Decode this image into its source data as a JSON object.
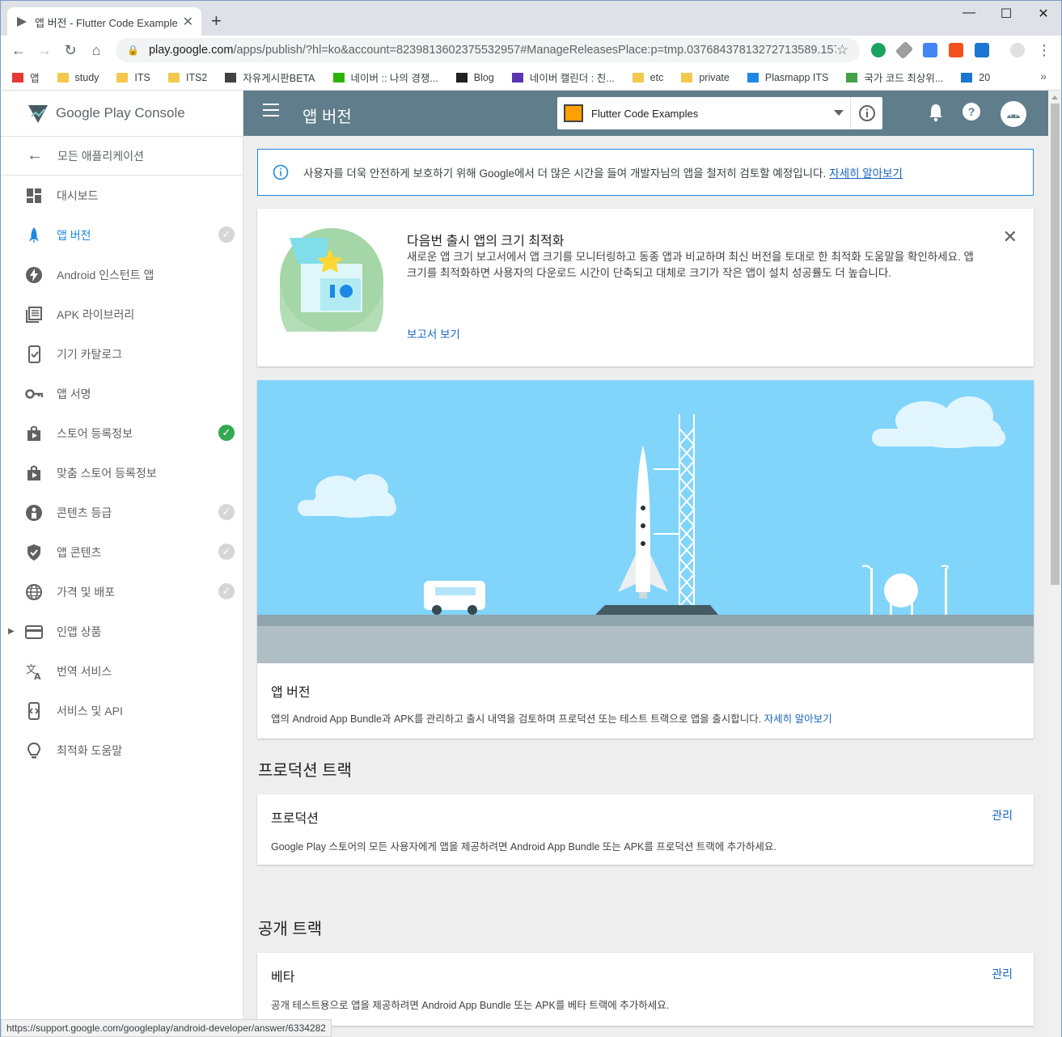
{
  "browser": {
    "tab_title": "앱 버전 - Flutter Code Example",
    "tab_close": "✕",
    "new_tab": "+",
    "window_controls": {
      "minimize": "—",
      "maximize": "☐",
      "close": "✕"
    },
    "url_host": "play.google.com",
    "url_path": "/apps/publish/?hl=ko&account=8239813602375532957#ManageReleasesPlace:p=tmp.03768437813272713589.157...",
    "bookmarks": [
      {
        "label": "앱",
        "icon": "apps-grid-icon"
      },
      {
        "label": "study",
        "icon": "folder-icon"
      },
      {
        "label": "ITS",
        "icon": "folder-icon"
      },
      {
        "label": "ITS2",
        "icon": "folder-icon"
      },
      {
        "label": "자유게시판BETA",
        "icon": "monitor-icon"
      },
      {
        "label": "네이버 :: 나의 경쟁...",
        "icon": "naver-icon"
      },
      {
        "label": "Blog",
        "icon": "dots-icon"
      },
      {
        "label": "네이버 캘린더 : 친...",
        "icon": "calendar-icon"
      },
      {
        "label": "etc",
        "icon": "folder-icon"
      },
      {
        "label": "private",
        "icon": "folder-icon"
      },
      {
        "label": "Plasmapp ITS",
        "icon": "plasmapp-icon"
      },
      {
        "label": "국가 코드 최상위...",
        "icon": "globe-icon"
      },
      {
        "label": "20",
        "icon": "s-icon"
      }
    ],
    "bookmarks_more": "»",
    "status_url": "https://support.google.com/googleplay/android-developer/answer/6334282"
  },
  "sidebar": {
    "logo_text": "Google Play Console",
    "back_label": "모든 애플리케이션",
    "items": [
      {
        "label": "대시보드",
        "icon": "dashboard-icon",
        "check": "none"
      },
      {
        "label": "앱 버전",
        "icon": "rocket-icon",
        "check": "grey",
        "active": true
      },
      {
        "label": "Android 인스턴트 앱",
        "icon": "bolt-icon",
        "check": "none"
      },
      {
        "label": "APK 라이브러리",
        "icon": "library-icon",
        "check": "none"
      },
      {
        "label": "기기 카탈로그",
        "icon": "device-icon",
        "check": "none"
      },
      {
        "label": "앱 서명",
        "icon": "key-icon",
        "check": "none"
      },
      {
        "label": "스토어 등록정보",
        "icon": "store-icon",
        "check": "green"
      },
      {
        "label": "맞춤 스토어 등록정보",
        "icon": "store-icon",
        "check": "none"
      },
      {
        "label": "콘텐츠 등급",
        "icon": "rating-icon",
        "check": "grey"
      },
      {
        "label": "앱 콘텐츠",
        "icon": "shield-icon",
        "check": "grey"
      },
      {
        "label": "가격 및 배포",
        "icon": "globe-icon",
        "check": "grey"
      },
      {
        "label": "인앱 상품",
        "icon": "card-icon",
        "check": "none",
        "expandable": true
      },
      {
        "label": "번역 서비스",
        "icon": "translate-icon",
        "check": "none"
      },
      {
        "label": "서비스 및 API",
        "icon": "api-icon",
        "check": "none"
      },
      {
        "label": "최적화 도움말",
        "icon": "bulb-icon",
        "check": "none"
      }
    ]
  },
  "appbar": {
    "title": "앱 버전",
    "app_name": "Flutter Code Examples"
  },
  "notice": {
    "text": "사용자를 더욱 안전하게 보호하기 위해 Google에서 더 많은 시간을 들여 개발자님의 앱을 철저히 검토할 예정입니다.",
    "link": "자세히 알아보기"
  },
  "optimize_card": {
    "title": "다음번 출시 앱의 크기 최적화",
    "description": "새로운 앱 크기 보고서에서 앱 크기를 모니터링하고 동종 앱과 비교하며 최신 버전을 토대로 한 최적화 도움말을 확인하세요. 앱 크기를 최적화하면 사용자의 다운로드 시간이 단축되고 대체로 크기가 작은 앱이 설치 성공률도 더 높습니다.",
    "link": "보고서 보기",
    "close": "✕"
  },
  "hero_card": {
    "title": "앱 버전",
    "description": "앱의 Android App Bundle과 APK를 관리하고 출시 내역을 검토하며 프로덕션 또는 테스트 트랙으로 앱을 출시합니다.",
    "link": "자세히 알아보기"
  },
  "production_section": {
    "heading": "프로덕션 트랙",
    "track_title": "프로덕션",
    "manage": "관리",
    "description": "Google Play 스토어의 모든 사용자에게 앱을 제공하려면 Android App Bundle 또는 APK를 프로덕션 트랙에 추가하세요."
  },
  "open_section": {
    "heading": "공개 트랙",
    "track_title": "베타",
    "manage": "관리",
    "description": "공개 테스트용으로 앱을 제공하려면 Android App Bundle 또는 APK를 베타 트랙에 추가하세요."
  },
  "colors": {
    "appbar": "#607d8b",
    "accent": "#1e88e5",
    "link": "#1565c0",
    "check_green": "#34a853",
    "sky": "#81d4fa"
  }
}
